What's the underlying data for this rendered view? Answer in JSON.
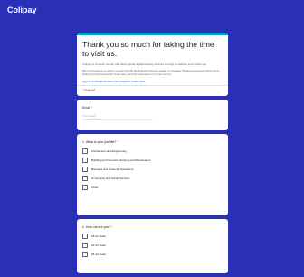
{
  "app": {
    "logo": "Colipay"
  },
  "intro": {
    "title": "Thank you so much for taking the time to visit us.",
    "paragraph1": "Colipay is a fintech startup that offers global digital banking services through its website and mobile app.",
    "paragraph2": "We're focused on a variety of user-friendly applications that are simple to navigate. Please let us know what you'd looking for and what kind of services you'd be interested in in your country.",
    "link_text": "Sign in to Google to save your progress. Learn more",
    "required_note": "* Required"
  },
  "email_question": {
    "label": "Email",
    "required_mark": "*",
    "placeholder": "Your email"
  },
  "job_question": {
    "label": "1. What is your job title?",
    "required_mark": "*",
    "options": [
      "Architecture and Engineering",
      "Building and Grounds Cleaning and Maintenance",
      "Business and Financial Operations",
      "Community and Social Services",
      "Other"
    ]
  },
  "age_question": {
    "label": "2. How old are you?",
    "required_mark": "*",
    "options": [
      "18-24 Years",
      "25-34 Years",
      "35-44 Years"
    ]
  }
}
